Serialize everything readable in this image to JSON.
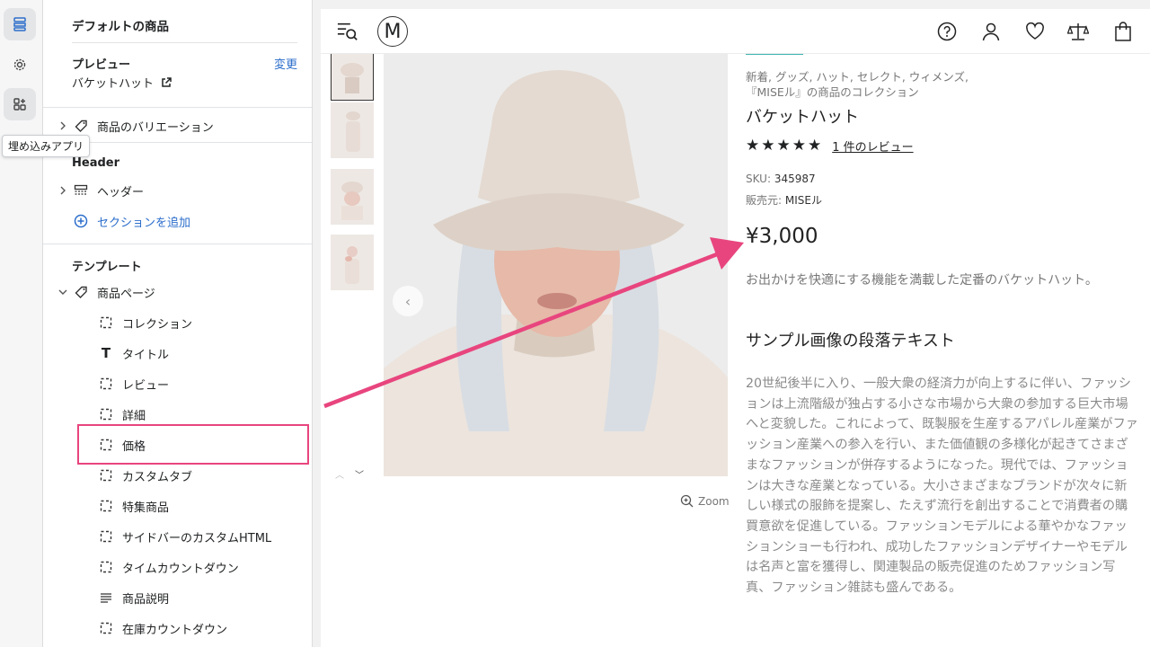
{
  "rail": {
    "tooltip": "埋め込みアプリ"
  },
  "panel": {
    "title": "デフォルトの商品",
    "preview_label": "プレビュー",
    "preview_change": "変更",
    "preview_value": "バケットハット",
    "variations": "商品のバリエーション",
    "header_section": "Header",
    "header_item": "ヘッダー",
    "add_section": "セクションを追加",
    "template_section": "テンプレート",
    "product_page": "商品ページ",
    "blocks": [
      {
        "label": "コレクション",
        "icon": "block-icon"
      },
      {
        "label": "タイトル",
        "icon": "text-icon"
      },
      {
        "label": "レビュー",
        "icon": "block-icon"
      },
      {
        "label": "詳細",
        "icon": "block-icon"
      },
      {
        "label": "価格",
        "icon": "block-icon"
      },
      {
        "label": "カスタムタブ",
        "icon": "block-icon"
      },
      {
        "label": "特集商品",
        "icon": "block-icon"
      },
      {
        "label": "サイドバーのカスタムHTML",
        "icon": "block-icon"
      },
      {
        "label": "タイムカウントダウン",
        "icon": "block-icon"
      },
      {
        "label": "商品説明",
        "icon": "lines-icon"
      },
      {
        "label": "在庫カウントダウン",
        "icon": "block-icon"
      }
    ]
  },
  "storefront": {
    "logo": "M",
    "zoom_label": "Zoom",
    "categories_line1": "新着, グッズ, ハット, セレクト, ウィメンズ,",
    "categories_line2": "『MISEル』の商品のコレクション",
    "product_name": "バケットハット",
    "stars": "★★★★★",
    "rating": 5,
    "review_link": "1 件のレビュー",
    "sku_label": "SKU:",
    "sku_value": "345987",
    "vendor_label": "販売元:",
    "vendor_value": "MISEル",
    "price": "¥3,000",
    "short_desc": "お出かけを快適にする機能を満載した定番のバケットハット。",
    "subheading": "サンプル画像の段落テキスト",
    "paragraph": "20世紀後半に入り、一般大衆の経済力が向上するに伴い、ファッションは上流階級が独占する小さな市場から大衆の参加する巨大市場へと変貌した。これによって、既製服を生産するアパレル産業がファッション産業への参入を行い、また価値観の多様化が起きてさまざまなファッションが併存するようになった。現代では、ファッションは大きな産業となっている。大小さまざまなブランドが次々に新しい様式の服飾を提案し、たえず流行を創出することで消費者の購買意欲を促進している。ファッションモデルによる華やかなファッションショーも行われ、成功したファッションデザイナーやモデルは名声と富を獲得し、関連製品の販売促進のためファッション写真、ファッション雑誌も盛んである。"
  },
  "colors": {
    "highlight": "#e8457e",
    "link": "#2c6ecb",
    "accent_bar": "#3fb3b0"
  }
}
